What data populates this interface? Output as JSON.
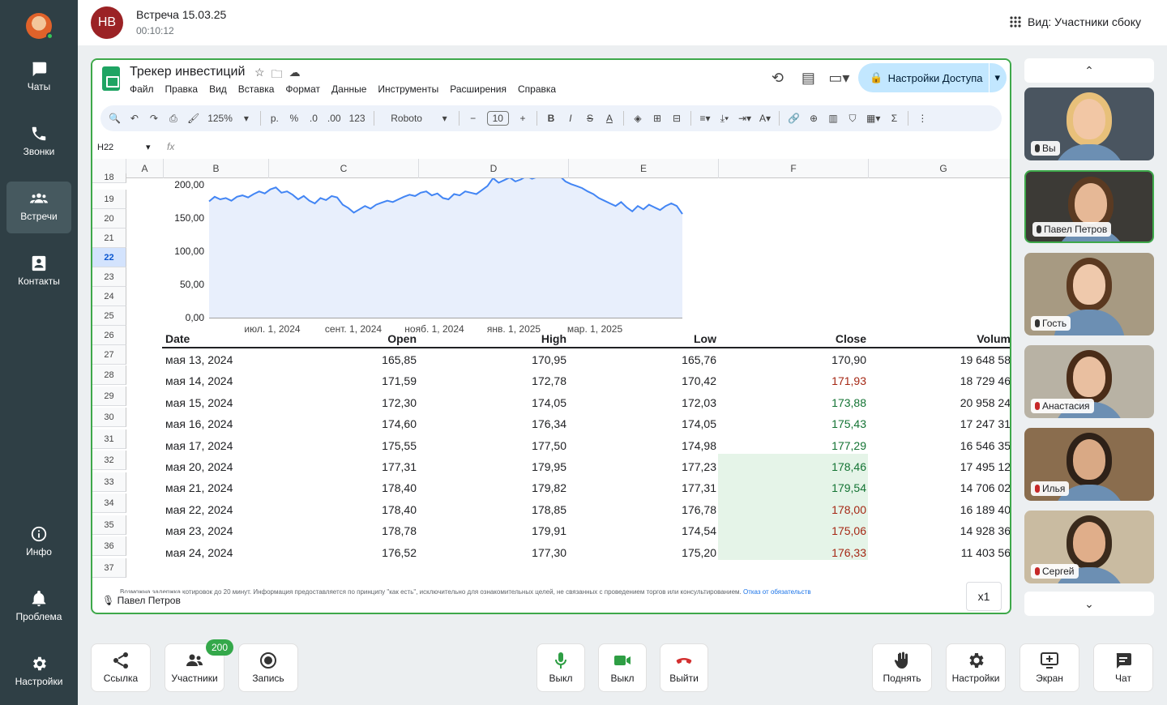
{
  "sidebar": {
    "items": [
      {
        "label": "Чаты",
        "icon": "chat-icon"
      },
      {
        "label": "Звонки",
        "icon": "phone-icon"
      },
      {
        "label": "Встречи",
        "icon": "people-icon"
      },
      {
        "label": "Контакты",
        "icon": "contacts-icon"
      },
      {
        "label": "Инфо",
        "icon": "info-icon"
      },
      {
        "label": "Проблема",
        "icon": "bell-icon"
      },
      {
        "label": "Настройки",
        "icon": "gear-icon"
      }
    ]
  },
  "meeting": {
    "initials": "НВ",
    "title": "Встреча 15.03.25",
    "duration": "00:10:12",
    "view_mode": "Вид: Участники сбоку"
  },
  "sheet": {
    "title": "Трекер инвестиций",
    "menu": [
      "Файл",
      "Правка",
      "Вид",
      "Вставка",
      "Формат",
      "Данные",
      "Инструменты",
      "Расширения",
      "Справка"
    ],
    "access_button": "Настройки Доступа",
    "toolbar": {
      "zoom": "125%",
      "currency": "р.",
      "percent": "%",
      "dec_less": ".0",
      "dec_more": ".00",
      "number_format": "123",
      "font": "Roboto",
      "font_size": "10"
    },
    "name_box": "H22",
    "fx": "fx",
    "columns": [
      "A",
      "B",
      "C",
      "D",
      "E",
      "F",
      "G"
    ],
    "rows": [
      "18",
      "19",
      "20",
      "21",
      "22",
      "23",
      "24",
      "25",
      "26",
      "27",
      "28",
      "29",
      "30",
      "31",
      "32",
      "33",
      "34",
      "35",
      "36",
      "37"
    ],
    "selected_row": "22",
    "table_headers": {
      "date": "Date",
      "open": "Open",
      "high": "High",
      "low": "Low",
      "close": "Close",
      "volume": "Volum"
    },
    "table": [
      {
        "date": "мая 13, 2024",
        "open": "165,85",
        "high": "170,95",
        "low": "165,76",
        "close": "170,90",
        "volume": "19 648 58",
        "trend": "none"
      },
      {
        "date": "мая 14, 2024",
        "open": "171,59",
        "high": "172,78",
        "low": "170,42",
        "close": "171,93",
        "volume": "18 729 46",
        "trend": "red"
      },
      {
        "date": "мая 15, 2024",
        "open": "172,30",
        "high": "174,05",
        "low": "172,03",
        "close": "173,88",
        "volume": "20 958 24",
        "trend": "green"
      },
      {
        "date": "мая 16, 2024",
        "open": "174,60",
        "high": "176,34",
        "low": "174,05",
        "close": "175,43",
        "volume": "17 247 31",
        "trend": "green"
      },
      {
        "date": "мая 17, 2024",
        "open": "175,55",
        "high": "177,50",
        "low": "174,98",
        "close": "177,29",
        "volume": "16 546 35",
        "trend": "green"
      },
      {
        "date": "мая 20, 2024",
        "open": "177,31",
        "high": "179,95",
        "low": "177,23",
        "close": "178,46",
        "volume": "17 495 12",
        "trend": "green"
      },
      {
        "date": "мая 21, 2024",
        "open": "178,40",
        "high": "179,82",
        "low": "177,31",
        "close": "179,54",
        "volume": "14 706 02",
        "trend": "green"
      },
      {
        "date": "мая 22, 2024",
        "open": "178,40",
        "high": "178,85",
        "low": "176,78",
        "close": "178,00",
        "volume": "16 189 40",
        "trend": "red"
      },
      {
        "date": "мая 23, 2024",
        "open": "178,78",
        "high": "179,91",
        "low": "174,54",
        "close": "175,06",
        "volume": "14 928 36",
        "trend": "red"
      },
      {
        "date": "мая 24, 2024",
        "open": "176,52",
        "high": "177,30",
        "low": "175,20",
        "close": "176,33",
        "volume": "11 403 56",
        "trend": "red"
      }
    ],
    "disclaimer": "Возможна задержка котировок до 20 минут. Информация предоставляется по принципу \"как есть\", исключительно для ознакомительных целей, не связанных с проведением торгов или консультированием.",
    "disclaimer_link": "Отказ от обязательств",
    "speaker": "Павел Петров",
    "zoom_tag": "x1"
  },
  "chart_data": {
    "type": "area",
    "yticks": [
      "200,00",
      "150,00",
      "100,00",
      "50,00",
      "0,00"
    ],
    "xticks": [
      "июл. 1, 2024",
      "сент. 1, 2024",
      "нояб. 1, 2024",
      "янв. 1, 2025",
      "мар. 1, 2025"
    ],
    "ylim": [
      0,
      200
    ],
    "series_color": "#4285f4",
    "values": [
      175,
      182,
      178,
      180,
      176,
      182,
      184,
      181,
      186,
      190,
      187,
      193,
      196,
      188,
      190,
      185,
      178,
      183,
      176,
      172,
      180,
      177,
      183,
      181,
      170,
      165,
      158,
      163,
      168,
      164,
      170,
      173,
      176,
      174,
      178,
      182,
      185,
      183,
      188,
      190,
      184,
      187,
      180,
      178,
      186,
      184,
      190,
      188,
      186,
      192,
      198,
      210,
      203,
      207,
      211,
      205,
      208,
      213,
      209,
      212,
      216,
      214,
      218,
      213,
      205,
      201,
      198,
      195,
      190,
      186,
      180,
      176,
      172,
      168,
      174,
      166,
      160,
      168,
      163,
      170,
      166,
      162,
      168,
      172,
      168,
      156
    ]
  },
  "participants": [
    {
      "name": "Вы",
      "mic": "on",
      "skin": "#f2c7a5",
      "hair": "#e8c07a",
      "bg": "#4a5560"
    },
    {
      "name": "Павел Петров",
      "mic": "on",
      "skin": "#e6b896",
      "hair": "#5a3a22",
      "bg": "#3c3a36"
    },
    {
      "name": "Гость",
      "mic": "on",
      "skin": "#efc9ac",
      "hair": "#5b3920",
      "bg": "#a79a82"
    },
    {
      "name": "Анастасия",
      "mic": "off",
      "skin": "#e9bfa0",
      "hair": "#4a2c18",
      "bg": "#b8b2a4"
    },
    {
      "name": "Илья",
      "mic": "off",
      "skin": "#d9a985",
      "hair": "#2e2118",
      "bg": "#8a6d4e"
    },
    {
      "name": "Сергей",
      "mic": "off",
      "skin": "#e0ae8a",
      "hair": "#3a2a1c",
      "bg": "#c9bba1"
    }
  ],
  "bottom": {
    "link": "Ссылка",
    "participants": "Участники",
    "participants_count": "200",
    "record": "Запись",
    "mic": "Выкл",
    "camera": "Выкл",
    "leave": "Выйти",
    "raise": "Поднять",
    "settings": "Настройки",
    "screen": "Экран",
    "chat": "Чат"
  },
  "colors": {
    "accent_green": "#3ea84a",
    "sidebar": "#2f3f45",
    "danger": "#d32f2f",
    "meeting_avatar": "#9b2225"
  }
}
